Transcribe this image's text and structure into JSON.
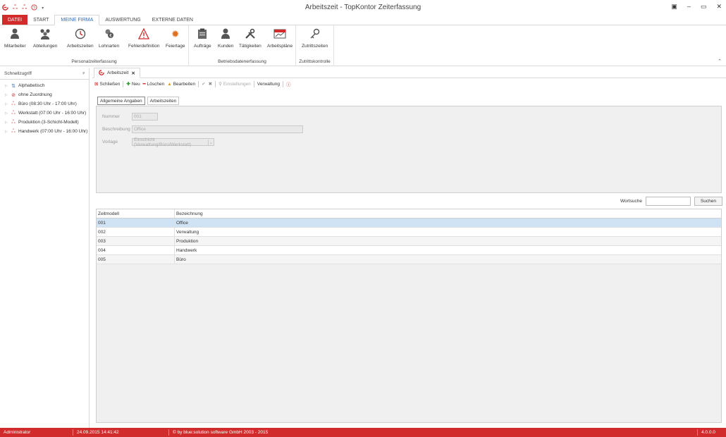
{
  "window": {
    "title": "Arbeitszeit - TopKontor Zeiterfassung",
    "quick_access": [
      "app-logo-icon",
      "users-icon",
      "users-icon",
      "help-icon"
    ]
  },
  "ribbon_tabs": [
    {
      "label": "DATEI"
    },
    {
      "label": "START"
    },
    {
      "label": "MEINE FIRMA"
    },
    {
      "label": "AUSWERTUNG"
    },
    {
      "label": "EXTERNE DATEN"
    }
  ],
  "ribbon": {
    "groups": [
      {
        "label": "Personalzeiterfassung",
        "buttons": [
          {
            "label": "Mitarbeiter",
            "icon": "person-icon"
          },
          {
            "label": "Abteilungen",
            "icon": "group-icon"
          },
          {
            "label": "Arbeitszeiten",
            "icon": "clock-icon"
          },
          {
            "label": "Lohnarten",
            "icon": "coins-icon"
          },
          {
            "label": "Fehlerdefinition",
            "icon": "warning-icon"
          },
          {
            "label": "Feiertage",
            "icon": "sun-icon"
          }
        ]
      },
      {
        "label": "Betriebsdatenerfassung",
        "buttons": [
          {
            "label": "Aufträge",
            "icon": "clipboard-icon"
          },
          {
            "label": "Kunden",
            "icon": "customer-icon"
          },
          {
            "label": "Tätigkeiten",
            "icon": "tools-icon"
          },
          {
            "label": "Arbeitspläne",
            "icon": "plan-icon"
          }
        ]
      },
      {
        "label": "Zutrittskontrolle",
        "buttons": [
          {
            "label": "Zutrittszeiten",
            "icon": "key-icon"
          }
        ]
      }
    ]
  },
  "quickaccess": {
    "title": "Schnellzugriff",
    "items": [
      {
        "label": "Alphabetisch",
        "icon": "sort-az-icon"
      },
      {
        "label": "ohne Zuordnung",
        "icon": "no-entry-icon"
      },
      {
        "label": "Büro (08:30 Uhr - 17:00 Uhr)",
        "icon": "users-icon"
      },
      {
        "label": "Werkstatt (07:00 Uhr - 16:00 Uhr)",
        "icon": "users-icon"
      },
      {
        "label": "Produktion (3-Schicht-Modell)",
        "icon": "users-icon"
      },
      {
        "label": "Handwerk (07:00 Uhr - 16:00 Uhr)",
        "icon": "users-icon"
      }
    ]
  },
  "doc_tab": {
    "label": "Arbeitszeit"
  },
  "toolbar": {
    "close": "Schließen",
    "new": "Neu",
    "delete": "Löschen",
    "edit": "Bearbeiten",
    "settings": "Einstellungen",
    "manage": "Verwaltung"
  },
  "subtabs": [
    {
      "label": "Allgemeine Angaben"
    },
    {
      "label": "Arbeitszeiten"
    }
  ],
  "form": {
    "number_label": "Nummer",
    "number_value": "001",
    "description_label": "Beschreibung",
    "description_value": "Office",
    "template_label": "Vorlage",
    "template_value": "Einschicht (Verwaltung/Büro/Werkstatt)"
  },
  "search": {
    "label": "Wortsuche",
    "button": "Suchen"
  },
  "grid": {
    "columns": [
      "Zeitmodell",
      "Bezeichnung"
    ],
    "rows": [
      {
        "id": "001",
        "name": "Office"
      },
      {
        "id": "002",
        "name": "Verwaltung"
      },
      {
        "id": "003",
        "name": "Produktion"
      },
      {
        "id": "004",
        "name": "Handwerk"
      },
      {
        "id": "005",
        "name": "Büro"
      }
    ],
    "selected_index": 0
  },
  "status": {
    "user": "Administrator",
    "datetime": "24.09.2015 14:41:42",
    "copyright": "© by blue:solution software GmbH 2003 - 2015",
    "version": "4.0.0.0"
  },
  "colors": {
    "accent": "#d22b2b",
    "selection": "#cfe3f5",
    "tab_active": "#2a6ebb"
  }
}
